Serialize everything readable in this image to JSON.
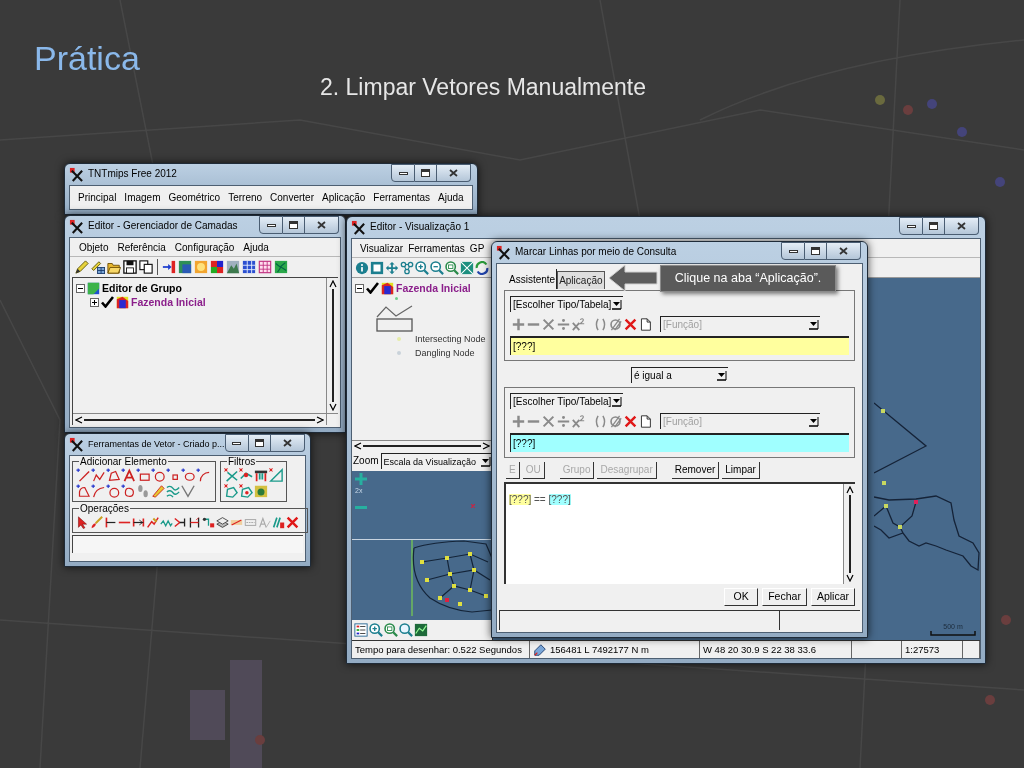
{
  "slide": {
    "title": "Prática",
    "subtitle": "2. Limpar Vetores Manualmente"
  },
  "main_window": {
    "title": "TNTmips Free 2012",
    "menu": [
      "Principal",
      "Imagem",
      "Geométrico",
      "Terreno",
      "Converter",
      "Aplicação",
      "Ferramentas",
      "Ajuda"
    ]
  },
  "layer_manager": {
    "title": "Editor - Gerenciador de Camadas",
    "menu": [
      "Objeto",
      "Referência",
      "Configuração",
      "Ajuda"
    ],
    "tree": [
      {
        "kind": "group",
        "label": "Editor de Grupo",
        "expanded": true,
        "children": [
          {
            "kind": "layer",
            "label": "Fazenda Inicial",
            "expanded": false,
            "checked": true
          }
        ]
      }
    ]
  },
  "vector_tools": {
    "title": "Ferramentas de Vetor - Criado p...",
    "groups": [
      {
        "label": "Adicionar Elemento"
      },
      {
        "label": "Filtros"
      },
      {
        "label": "Operações"
      }
    ]
  },
  "view_window": {
    "title": "Editor - Visualização 1",
    "menu": [
      "Visualizar",
      "Ferramentas",
      "GP"
    ],
    "layers": [
      {
        "kind": "layer",
        "label": "Fazenda Inicial",
        "expanded": true,
        "checked": true,
        "legend": [
          {
            "label": "Intersecting Node",
            "color": "#e6eca8"
          },
          {
            "label": "Dangling Node",
            "color": "#c9d2da"
          }
        ]
      }
    ],
    "zoom": {
      "label": "Zoom",
      "value": "Escala da Visualização",
      "factor": "2x"
    },
    "scale_bar": "500 m",
    "status_bar": [
      "Tempo para desenhar: 0.522 Segundos",
      "156481 L 7492177 N m",
      "W 48 20 30.9 S 22 38 33.6",
      "1:27573"
    ]
  },
  "query_dialog": {
    "title": "Marcar Linhas por meio de Consulta",
    "tabs": [
      {
        "label": "Assistente",
        "selected": true
      },
      {
        "label": "Aplicação",
        "selected": false
      }
    ],
    "callout": "Clique na aba “Aplicação”.",
    "operands": [
      {
        "table": "[Escolher Tipo/Tabela]",
        "function": {
          "label": "[Função]",
          "disabled": true
        },
        "value": "[???]",
        "color": "#ffff9e"
      },
      {
        "table": "[Escolher Tipo/Tabela]",
        "function": {
          "label": "[Função]",
          "disabled": true
        },
        "value": "[???]",
        "color": "#a0ffff"
      }
    ],
    "comparison": "é igual a",
    "buttons": [
      {
        "label": "E",
        "disabled": true
      },
      {
        "label": "OU",
        "disabled": true
      },
      {
        "label": "Grupo",
        "disabled": true
      },
      {
        "label": "Desagrupar",
        "disabled": true
      },
      {
        "label": "Remover",
        "disabled": false
      },
      {
        "label": "Limpar",
        "disabled": false
      }
    ],
    "expression": {
      "left": "[???]",
      "operator": "==",
      "right": "[???]"
    },
    "actions": [
      "OK",
      "Fechar",
      "Aplicar"
    ]
  }
}
